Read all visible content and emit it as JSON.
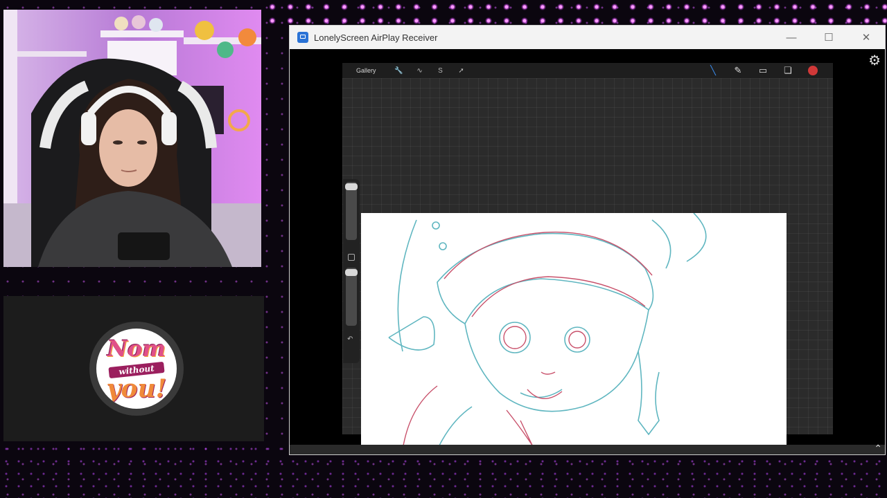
{
  "window": {
    "title": "LonelyScreen AirPlay Receiver",
    "minimize_icon": "minimize-icon",
    "maximize_icon": "maximize-icon",
    "close_icon": "close-icon"
  },
  "procreate": {
    "gallery_label": "Gallery",
    "tools": [
      "wrench-icon",
      "magic-wand-icon",
      "selection-icon",
      "transform-icon"
    ],
    "right_tools": [
      "brush-icon",
      "smudge-icon",
      "eraser-icon",
      "layers-icon"
    ],
    "active_color": "#d03838"
  },
  "logo": {
    "line1": "Nom",
    "line2": "without",
    "line3": "you!"
  },
  "colors": {
    "accent_purple": "#c850ff",
    "sketch_teal": "#5fb6c0",
    "sketch_red": "#c8506a"
  }
}
